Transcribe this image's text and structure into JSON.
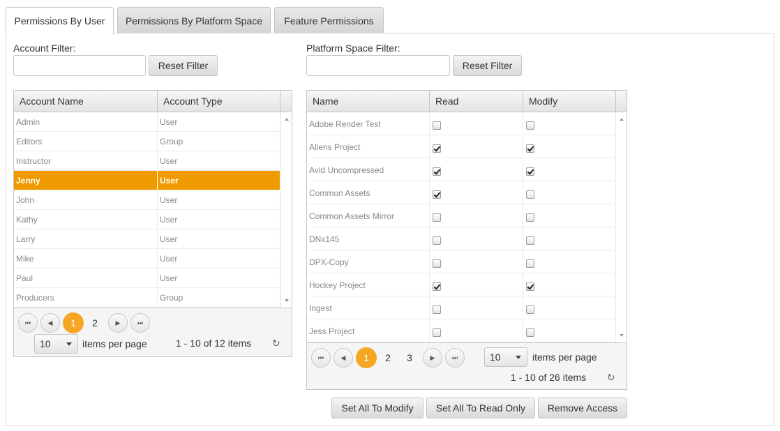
{
  "tabs": [
    {
      "label": "Permissions By User",
      "active": true
    },
    {
      "label": "Permissions By Platform Space",
      "active": false
    },
    {
      "label": "Feature Permissions",
      "active": false
    }
  ],
  "account_filter": {
    "label": "Account Filter:",
    "value": "",
    "reset_label": "Reset Filter"
  },
  "space_filter": {
    "label": "Platform Space Filter:",
    "value": "",
    "reset_label": "Reset Filter"
  },
  "accounts_grid": {
    "columns": [
      "Account Name",
      "Account Type"
    ],
    "rows": [
      {
        "name": "Admin",
        "type": "User",
        "selected": false
      },
      {
        "name": "Editors",
        "type": "Group",
        "selected": false
      },
      {
        "name": "Instructor",
        "type": "User",
        "selected": false
      },
      {
        "name": "Jenny",
        "type": "User",
        "selected": true
      },
      {
        "name": "John",
        "type": "User",
        "selected": false
      },
      {
        "name": "Kathy",
        "type": "User",
        "selected": false
      },
      {
        "name": "Larry",
        "type": "User",
        "selected": false
      },
      {
        "name": "Mike",
        "type": "User",
        "selected": false
      },
      {
        "name": "Paul",
        "type": "User",
        "selected": false
      },
      {
        "name": "Producers",
        "type": "Group",
        "selected": false
      }
    ],
    "pager": {
      "pages": [
        "1",
        "2"
      ],
      "current": "1",
      "page_size": "10",
      "items_per_page_label": "items per page",
      "summary": "1 - 10 of 12 items"
    }
  },
  "spaces_grid": {
    "columns": [
      "Name",
      "Read",
      "Modify"
    ],
    "rows": [
      {
        "name": "Adobe Render Test",
        "read": false,
        "modify": false
      },
      {
        "name": "Allens Project",
        "read": true,
        "modify": true
      },
      {
        "name": "Avid Uncompressed",
        "read": true,
        "modify": true
      },
      {
        "name": "Common Assets",
        "read": true,
        "modify": false
      },
      {
        "name": "Common Assets Mirror",
        "read": false,
        "modify": false
      },
      {
        "name": "DNx145",
        "read": false,
        "modify": false
      },
      {
        "name": "DPX-Copy",
        "read": false,
        "modify": false
      },
      {
        "name": "Hockey Project",
        "read": true,
        "modify": true
      },
      {
        "name": "Ingest",
        "read": false,
        "modify": false
      },
      {
        "name": "Jess Project",
        "read": false,
        "modify": false
      }
    ],
    "pager": {
      "pages": [
        "1",
        "2",
        "3"
      ],
      "current": "1",
      "page_size": "10",
      "items_per_page_label": "items per page",
      "summary": "1 - 10 of 26 items"
    }
  },
  "actions": {
    "set_modify": "Set All To Modify",
    "set_read_only": "Set All To Read Only",
    "remove_access": "Remove Access"
  },
  "colors": {
    "selected_row": "#ee9a00",
    "current_page": "#f5a623"
  }
}
